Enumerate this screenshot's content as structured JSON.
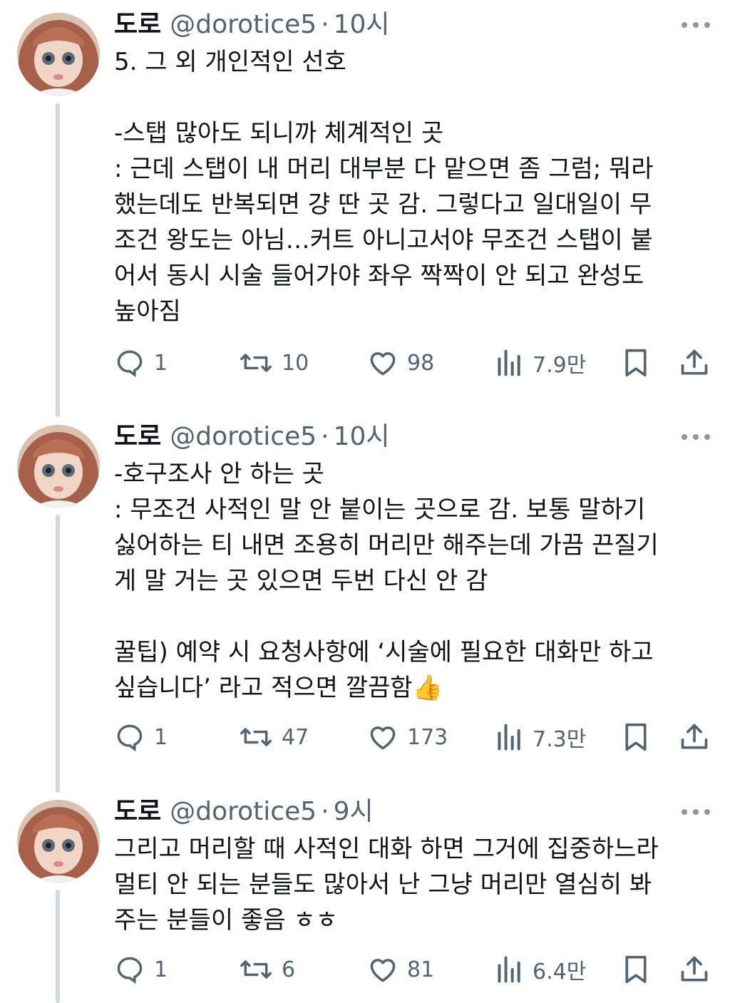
{
  "tweets": [
    {
      "name": "도로",
      "handle": "@dorotice5",
      "dot": "·",
      "time": "10시",
      "text": "5. 그 외 개인적인 선호\n\n-스탭 많아도 되니까 체계적인 곳\n: 근데 스탭이 내 머리 대부분 다 맡으면 좀 그럼; 뭐라\n했는데도 반복되면 걍 딴 곳 감. 그렇다고 일대일이 무\n조건 왕도는 아님…커트 아니고서야 무조건 스탭이 붙\n어서 동시 시술 들어가야 좌우 짝짝이 안 되고 완성도\n높아짐",
      "replies": "1",
      "retweets": "10",
      "likes": "98",
      "views": "7.9만"
    },
    {
      "name": "도로",
      "handle": "@dorotice5",
      "dot": "·",
      "time": "10시",
      "text": "-호구조사 안 하는 곳\n: 무조건 사적인 말 안 붙이는 곳으로 감. 보통 말하기\n싫어하는 티 내면 조용히 머리만 해주는데 가끔 끈질기\n게 말 거는 곳 있으면 두번 다신 안 감\n\n꿀팁) 예약 시 요청사항에 ‘시술에 필요한 대화만 하고\n싶습니다’ 라고 적으면 깔끔함",
      "emoji": "👍",
      "replies": "1",
      "retweets": "47",
      "likes": "173",
      "views": "7.3만"
    },
    {
      "name": "도로",
      "handle": "@dorotice5",
      "dot": "·",
      "time": "9시",
      "text": "그리고 머리할 때 사적인 대화 하면 그거에 집중하느라\n멀티 안 되는 분들도 많아서 난 그냥 머리만 열심히 봐\n주는 분들이 좋음 ㅎㅎ",
      "replies": "1",
      "retweets": "6",
      "likes": "81",
      "views": "6.4만"
    }
  ],
  "icons": {
    "reply": "reply-icon",
    "retweet": "retweet-icon",
    "like": "heart-icon",
    "views": "views-icon",
    "bookmark": "bookmark-icon",
    "share": "share-icon",
    "more": "more-icon"
  },
  "colors": {
    "text": "#0f1419",
    "secondary": "#536471",
    "thread_line": "#cfd9de"
  }
}
